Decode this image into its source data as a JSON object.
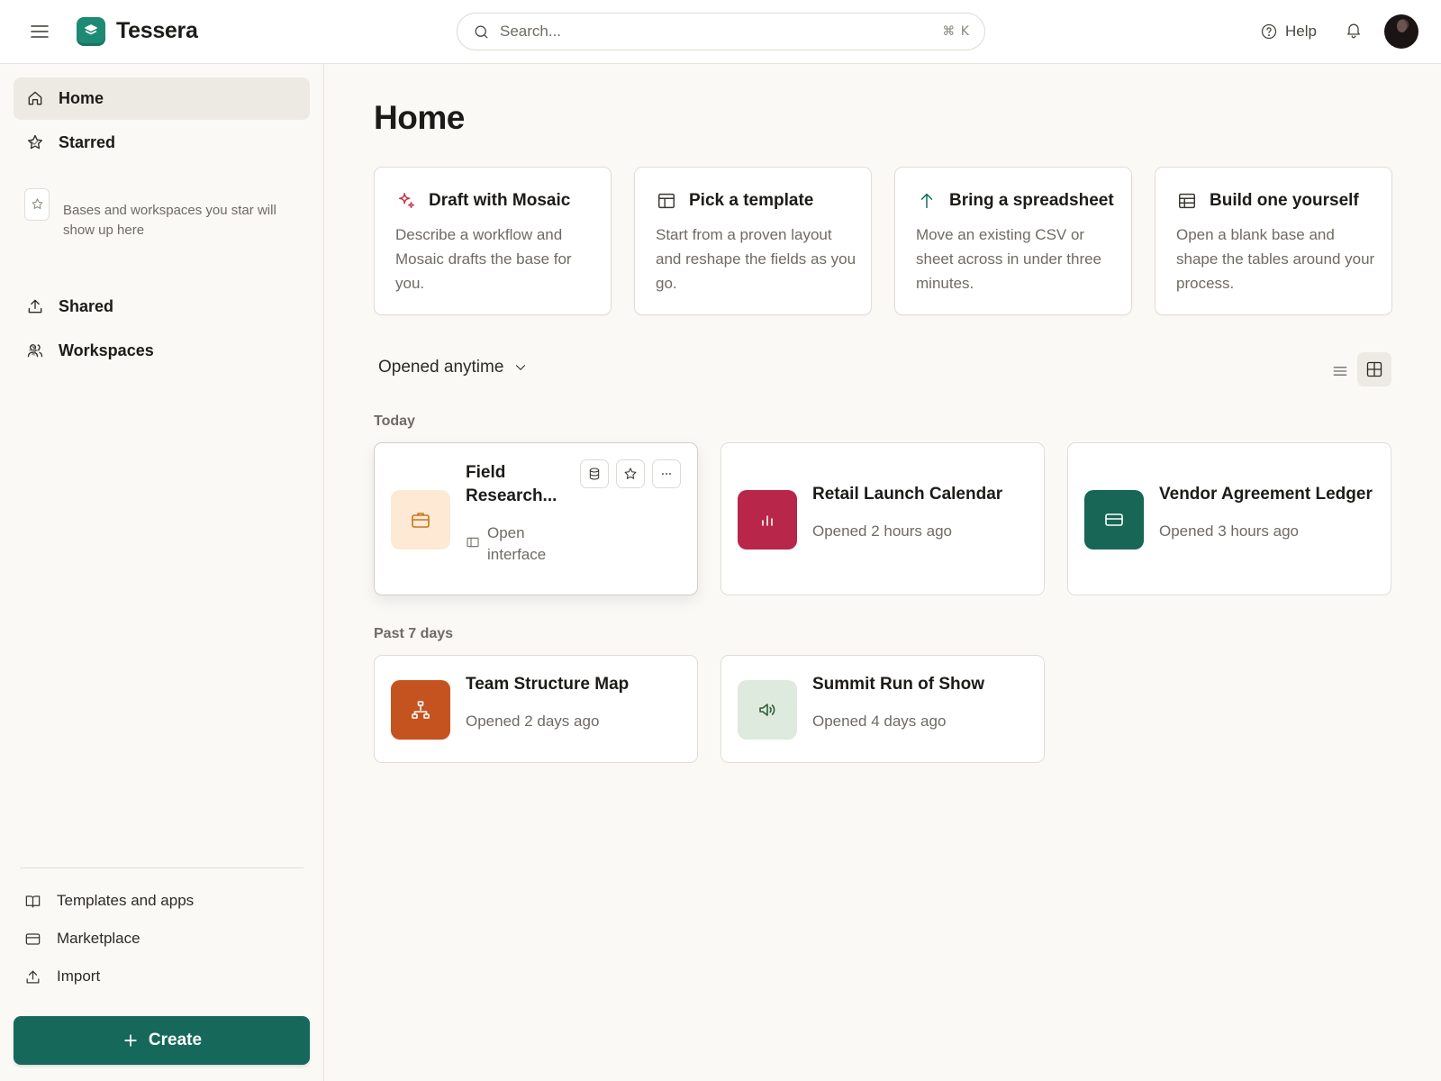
{
  "app": {
    "name": "Tessera",
    "logo_color": "#1d8a74"
  },
  "header": {
    "search_placeholder": "Search...",
    "search_shortcut": "⌘ K",
    "help_label": "Help",
    "icons": [
      "menu-icon",
      "search-icon",
      "help-circle-icon",
      "bell-icon",
      "avatar"
    ]
  },
  "sidebar": {
    "home_label": "Home",
    "starred_label": "Starred",
    "starred_empty_text": "Bases and workspaces you star will show up here",
    "shared_label": "Shared",
    "workspaces_label": "Workspaces",
    "footer": {
      "templates_label": "Templates and apps",
      "marketplace_label": "Marketplace",
      "import_label": "Import"
    },
    "create_label": "Create"
  },
  "main": {
    "title": "Home",
    "start_cards": [
      {
        "title": "Draft with Mosaic",
        "description": "Describe a workflow and Mosaic drafts the base for you.",
        "icon": "sparkle-icon"
      },
      {
        "title": "Pick a template",
        "description": "Start from a proven layout and reshape the fields as you go.",
        "icon": "template-icon"
      },
      {
        "title": "Bring a spreadsheet",
        "description": "Move an existing CSV or sheet across in under three minutes.",
        "icon": "arrow-up-icon"
      },
      {
        "title": "Build one yourself",
        "description": "Open a blank base and shape the tables around your process.",
        "icon": "table-icon"
      }
    ],
    "filter_label": "Opened anytime",
    "sections": {
      "today": "Today",
      "past7": "Past 7 days"
    },
    "recent_today": [
      {
        "name": "Field Research...",
        "action": "Open interface",
        "tile_color": "#fde9d4",
        "icon": "briefcase-icon"
      },
      {
        "name": "Retail Launch Calendar",
        "meta": "Opened 2 hours ago",
        "tile_color": "#b8264a",
        "icon": "bar-chart-icon"
      },
      {
        "name": "Vendor Agreement Ledger",
        "meta": "Opened 3 hours ago",
        "tile_color": "#176656",
        "icon": "card-icon"
      }
    ],
    "recent_past7": [
      {
        "name": "Team Structure Map",
        "meta": "Opened 2 days ago",
        "tile_color": "#c4531f",
        "icon": "org-chart-icon"
      },
      {
        "name": "Summit Run of Show",
        "meta": "Opened 4 days ago",
        "tile_color": "#deeadd",
        "icon": "megaphone-icon"
      }
    ]
  },
  "colors": {
    "accent": "#16695a",
    "sparkle": "#c43a4a",
    "arrow": "#16695a"
  }
}
